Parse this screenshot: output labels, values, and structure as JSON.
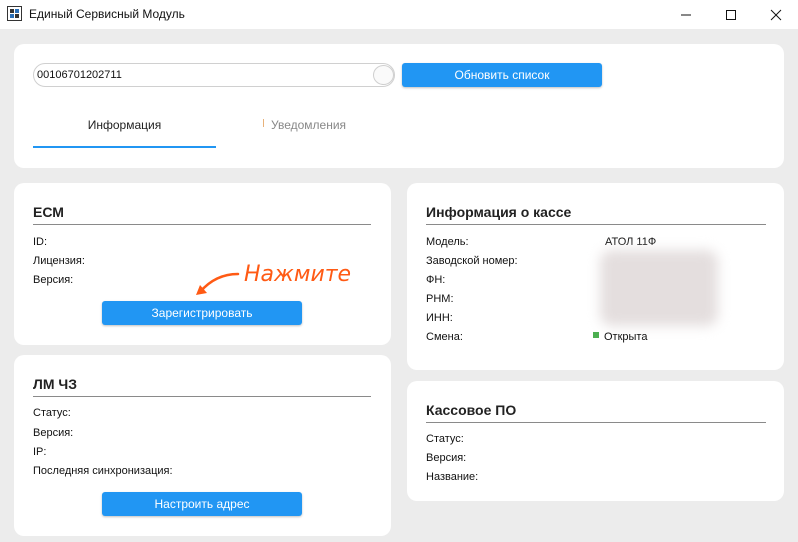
{
  "window": {
    "title": "Единый Сервисный Модуль"
  },
  "toolbar": {
    "search_value": "00106701202711",
    "refresh_label": "Обновить список"
  },
  "tabs": [
    {
      "label": "Информация",
      "active": true
    },
    {
      "label": "Уведомления",
      "active": false
    }
  ],
  "ecm": {
    "title": "ЕСМ",
    "id_label": "ID:",
    "license_label": "Лицензия:",
    "version_label": "Версия:",
    "register_label": "Зарегистрировать"
  },
  "annotation": {
    "text": "Нажмите"
  },
  "lm": {
    "title": "ЛМ ЧЗ",
    "status_label": "Статус:",
    "version_label": "Версия:",
    "ip_label": "IP:",
    "sync_label": "Последняя синхронизация:",
    "config_label": "Настроить адрес"
  },
  "kassa": {
    "title": "Информация о кассе",
    "model_label": "Модель:",
    "model_value": "АТОЛ 11Ф",
    "serial_label": "Заводской номер:",
    "fn_label": "ФН:",
    "rnm_label": "РНМ:",
    "inn_label": "ИНН:",
    "shift_label": "Смена:",
    "shift_value": "Открыта"
  },
  "po": {
    "title": "Кассовое ПО",
    "status_label": "Статус:",
    "version_label": "Версия:",
    "name_label": "Название:"
  },
  "colors": {
    "accent": "#2196f3",
    "annotation": "#ff5a14",
    "status_open": "#4caf50"
  }
}
